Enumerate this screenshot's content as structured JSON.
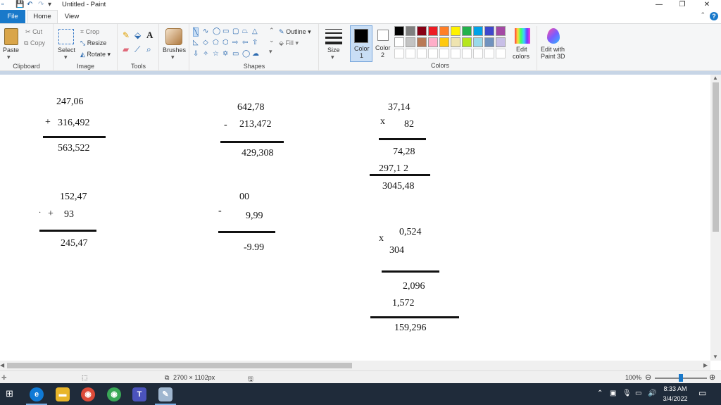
{
  "window": {
    "title": "Untitled - Paint"
  },
  "tabs": {
    "file": "File",
    "home": "Home",
    "view": "View"
  },
  "ribbon": {
    "clipboard": {
      "label": "Clipboard",
      "paste": "Paste",
      "cut": "Cut",
      "copy": "Copy"
    },
    "image": {
      "label": "Image",
      "select": "Select",
      "crop": "Crop",
      "resize": "Resize",
      "rotate": "Rotate"
    },
    "tools": {
      "label": "Tools"
    },
    "brushes": {
      "label": "Brushes"
    },
    "shapes": {
      "label": "Shapes",
      "outline": "Outline",
      "fill": "Fill"
    },
    "size": {
      "label": "Size"
    },
    "color1": {
      "label": "Color",
      "num": "1",
      "color": "#000000"
    },
    "color2": {
      "label": "Color",
      "num": "2",
      "color": "#ffffff"
    },
    "colors": {
      "label": "Colors",
      "row1": [
        "#000000",
        "#7f7f7f",
        "#880015",
        "#ed1c24",
        "#ff7f27",
        "#fff200",
        "#22b14c",
        "#00a2e8",
        "#3f48cc",
        "#a349a4"
      ],
      "row2": [
        "#ffffff",
        "#c3c3c3",
        "#b97a57",
        "#ffaec9",
        "#ffc90e",
        "#efe4b0",
        "#b5e61d",
        "#99d9ea",
        "#7092be",
        "#c8bfe7"
      ]
    },
    "edit_colors": {
      "line1": "Edit",
      "line2": "colors"
    },
    "paint3d": {
      "line1": "Edit with",
      "line2": "Paint 3D"
    }
  },
  "canvas": {
    "problem1": {
      "a": "247,06",
      "op": "+",
      "b": "316,492",
      "result": "563,522"
    },
    "problem2": {
      "a": "642,78",
      "op": "-",
      "b": "213,472",
      "result": "429,308"
    },
    "problem3": {
      "a": "37,14",
      "op": "x",
      "b": "82",
      "partial1": "74,28",
      "partial2": "297,1 2",
      "result": "3045,48"
    },
    "problem4": {
      "a": "152,47",
      "dot": "·",
      "op": "+",
      "b": "93",
      "result": "245,47"
    },
    "problem5": {
      "a": "00",
      "op": "-",
      "b": "9,99",
      "result": "-9.99"
    },
    "problem6": {
      "op": "x",
      "a": "0,524",
      "b": "304",
      "partial1": "2,096",
      "partial2": "1,572",
      "result": "159,296"
    }
  },
  "status": {
    "dimensions": "2700 × 1102px",
    "zoom": "100%"
  },
  "taskbar": {
    "time": "8:33 AM",
    "date": "3/4/2022"
  }
}
